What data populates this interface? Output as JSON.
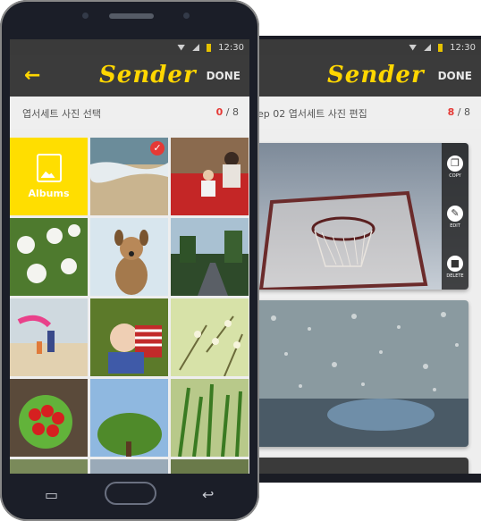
{
  "status": {
    "time": "12:30"
  },
  "back_screen": {
    "logo": "Sender",
    "done_label": "DONE",
    "step_label": "ep 02  엽서세트 사진 편집",
    "count_current": "8",
    "count_total": " / 8",
    "tools": [
      {
        "label": "COPY",
        "icon": "copy-icon"
      },
      {
        "label": "EDIT",
        "icon": "edit-icon"
      },
      {
        "label": "DELETE",
        "icon": "delete-icon"
      }
    ]
  },
  "front_screen": {
    "logo": "Sender",
    "done_label": "DONE",
    "back_icon": "←",
    "step_label": "엽서세트 사진 선택",
    "count_current": "0",
    "count_total": " / 8",
    "albums_label": "Albums",
    "selected_check": "✓"
  },
  "nav": {
    "recent": "▭",
    "back": "↩"
  },
  "colors": {
    "accent": "#ffd600",
    "selected": "#e53935",
    "appbar": "#3b3b3b"
  }
}
